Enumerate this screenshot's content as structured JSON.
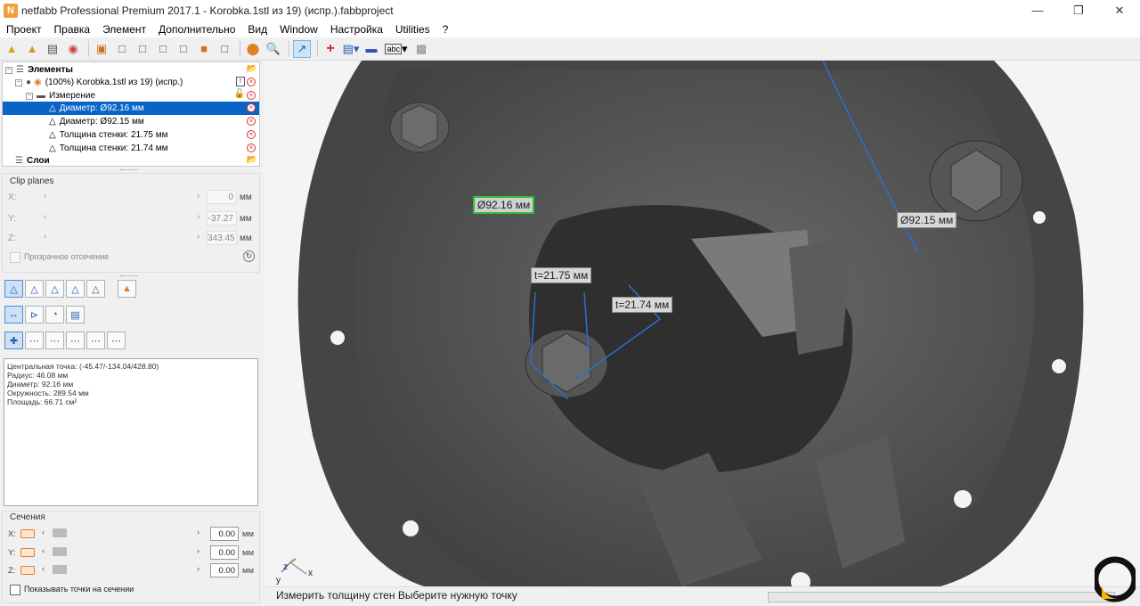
{
  "window": {
    "title": "netfabb Professional Premium 2017.1 - Korobka.1stl из 19) (испр.).fabbproject",
    "icon_letter": "N"
  },
  "menu": [
    "Проект",
    "Правка",
    "Элемент",
    "Дополнительно",
    "Вид",
    "Window",
    "Настройка",
    "Utilities",
    "?"
  ],
  "tree": {
    "root_label": "Элементы",
    "part_label": "(100%) Korobka.1stl из 19) (испр.)",
    "group_label": "Измерение",
    "items": [
      {
        "label": "Диаметр: Ø92.16 мм",
        "selected": true
      },
      {
        "label": "Диаметр: Ø92.15 мм",
        "selected": false
      },
      {
        "label": "Толщина стенки: 21.75 мм",
        "selected": false
      },
      {
        "label": "Толщина стенки: 21.74 мм",
        "selected": false
      }
    ],
    "layers_label": "Слои"
  },
  "clip_planes": {
    "title": "Clip planes",
    "rows": [
      {
        "axis": "X:",
        "value": "0",
        "unit": "мм"
      },
      {
        "axis": "Y:",
        "value": "-37.27",
        "unit": "мм"
      },
      {
        "axis": "Z:",
        "value": "343.45",
        "unit": "мм"
      }
    ],
    "transparent_label": "Прозрачное отсечение"
  },
  "info_lines": [
    "Центральная точка: (-45.47/-134.04/428.80)",
    "Радиус: 46.08 мм",
    "Диаметр: 92.16 мм",
    "Окружность: 289.54 мм",
    "Площадь: 66.71 см²"
  ],
  "sections": {
    "title": "Сечения",
    "rows": [
      {
        "axis": "X:",
        "value": "0.00",
        "unit": "мм"
      },
      {
        "axis": "Y:",
        "value": "0.00",
        "unit": "мм"
      },
      {
        "axis": "Z:",
        "value": "0.00",
        "unit": "мм"
      }
    ],
    "show_points_label": "Показывать точки на сечении"
  },
  "viewport_labels": {
    "d1": "Ø92.16 мм",
    "d2": "Ø92.15 мм",
    "t1": "t=21.75 мм",
    "t2": "t=21.74 мм"
  },
  "axes": {
    "z": "z",
    "x": "x",
    "y": "y"
  },
  "status": {
    "text": "Измерить толщину стен Выберите нужную точку"
  },
  "colors": {
    "accent": "#0a64c8",
    "active_label_border": "#2ec02e",
    "measure_line": "#2a6fd6"
  }
}
